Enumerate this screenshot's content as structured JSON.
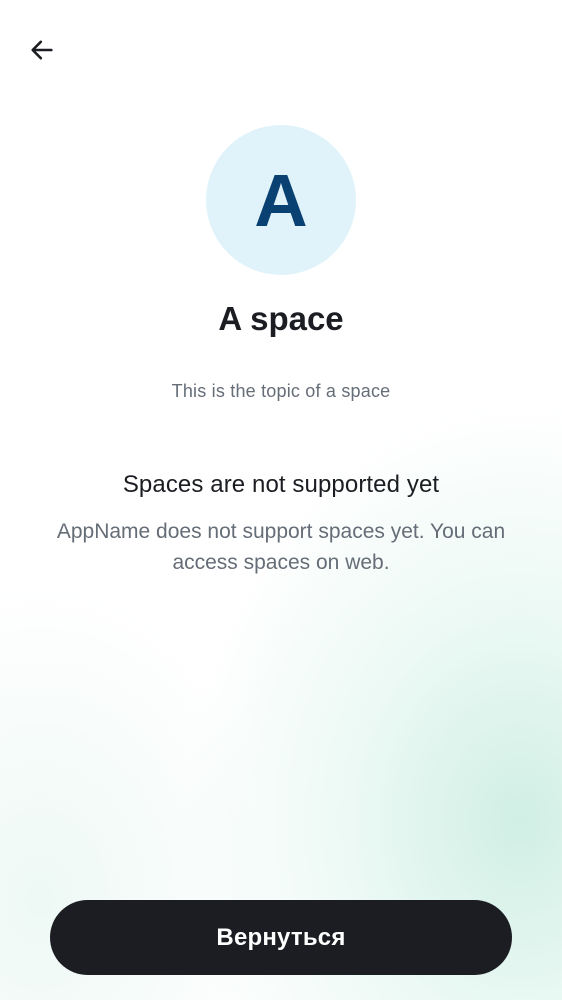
{
  "header": {
    "back_icon": "arrow-left-icon"
  },
  "space": {
    "avatar_letter": "A",
    "name": "A space",
    "topic": "This is the topic of a space"
  },
  "notice": {
    "title": "Spaces are not supported yet",
    "body": "AppName does not support spaces yet. You can access spaces on web."
  },
  "actions": {
    "back_label": "Вернуться"
  },
  "colors": {
    "avatar_background": "#e1f3fa",
    "avatar_letter": "#0a4173",
    "primary_button": "#1b1d22",
    "text_primary": "#1b1d22",
    "text_secondary": "#656d77"
  }
}
